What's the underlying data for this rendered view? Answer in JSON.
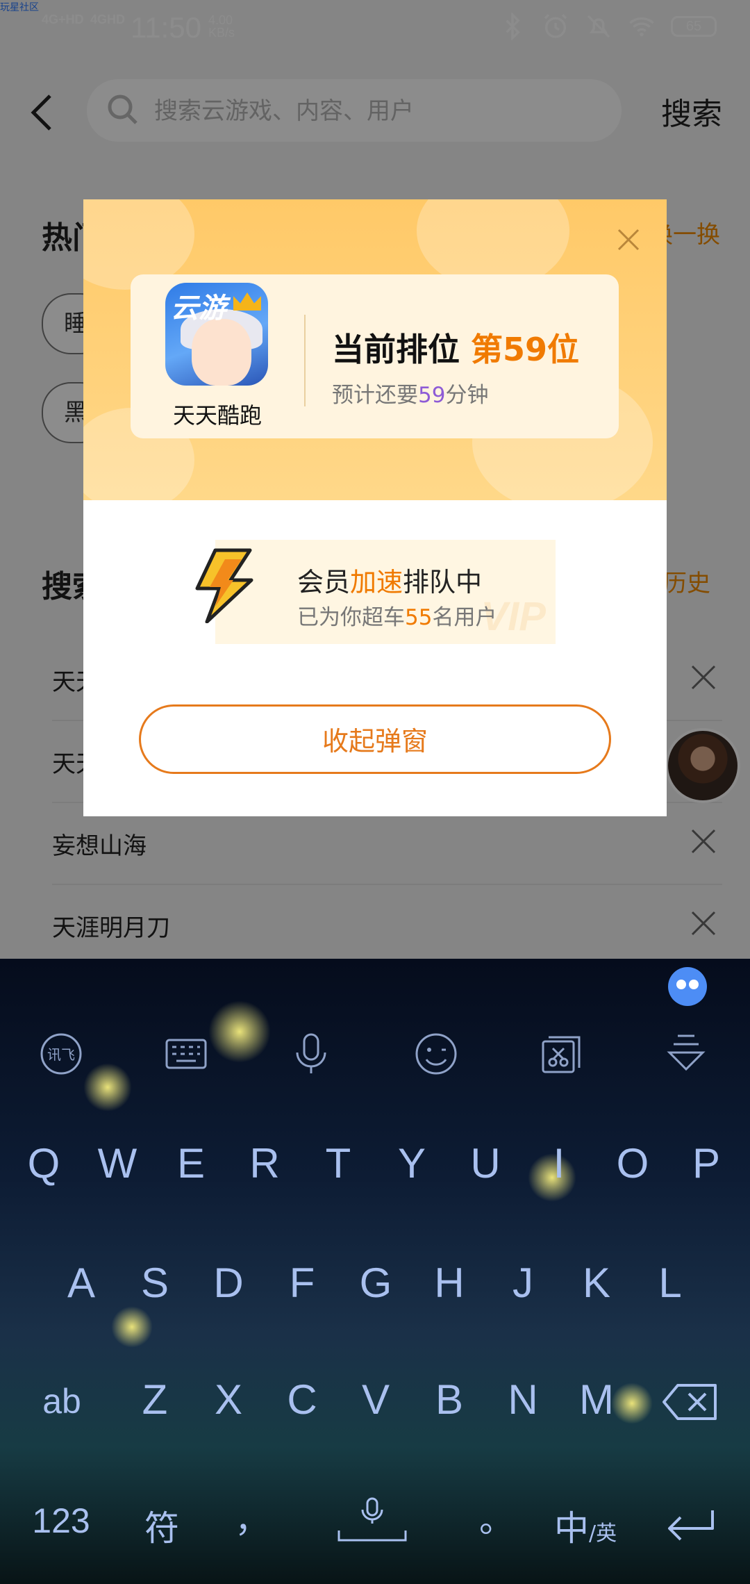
{
  "status_bar": {
    "corner_label": "玩星社区",
    "signal_1": "4G+HD",
    "signal_2": "4GHD",
    "time": "11:50",
    "speed_value": "4.00",
    "speed_unit": "KB/s",
    "battery": "65"
  },
  "header": {
    "search_placeholder": "搜索云游戏、内容、用户",
    "search_action": "搜索"
  },
  "page": {
    "hot_title": "热门",
    "hot_action": "换一换",
    "chips": [
      "睡",
      "黑"
    ],
    "history_title": "搜索",
    "history_action": "历史",
    "history_items": [
      "天天酷跑",
      "天天",
      "妄想山海",
      "天涯明月刀"
    ]
  },
  "modal": {
    "app_name": "天天酷跑",
    "app_icon_text": "云游",
    "rank_label": "当前排位",
    "rank_value": "第59位",
    "eta_prefix": "预计还要",
    "eta_minutes": "59",
    "eta_suffix": "分钟",
    "vip_title_1": "会员",
    "vip_title_2": "加速",
    "vip_title_3": "排队中",
    "vip_sub_prefix": "已为你超车",
    "vip_sub_count": "55",
    "vip_sub_suffix": "名用户",
    "vip_watermark": "VIP",
    "collapse_label": "收起弹窗"
  },
  "keyboard": {
    "row1": [
      "Q",
      "W",
      "E",
      "R",
      "T",
      "Y",
      "U",
      "I",
      "O",
      "P"
    ],
    "row2": [
      "A",
      "S",
      "D",
      "F",
      "G",
      "H",
      "J",
      "K",
      "L"
    ],
    "row3": [
      "Z",
      "X",
      "C",
      "V",
      "B",
      "N",
      "M"
    ],
    "shift_label": "ab",
    "num_label": "123",
    "symbol_label": "符",
    "comma_label": "，",
    "period_label": "。",
    "lang_label": "中",
    "lang_alt_label": "/英"
  },
  "colors": {
    "accent": "#f07a00",
    "purple_number": "#8e5bd6",
    "modal_top": "#ffc968",
    "keyboard_key": "#a9c0ef"
  }
}
